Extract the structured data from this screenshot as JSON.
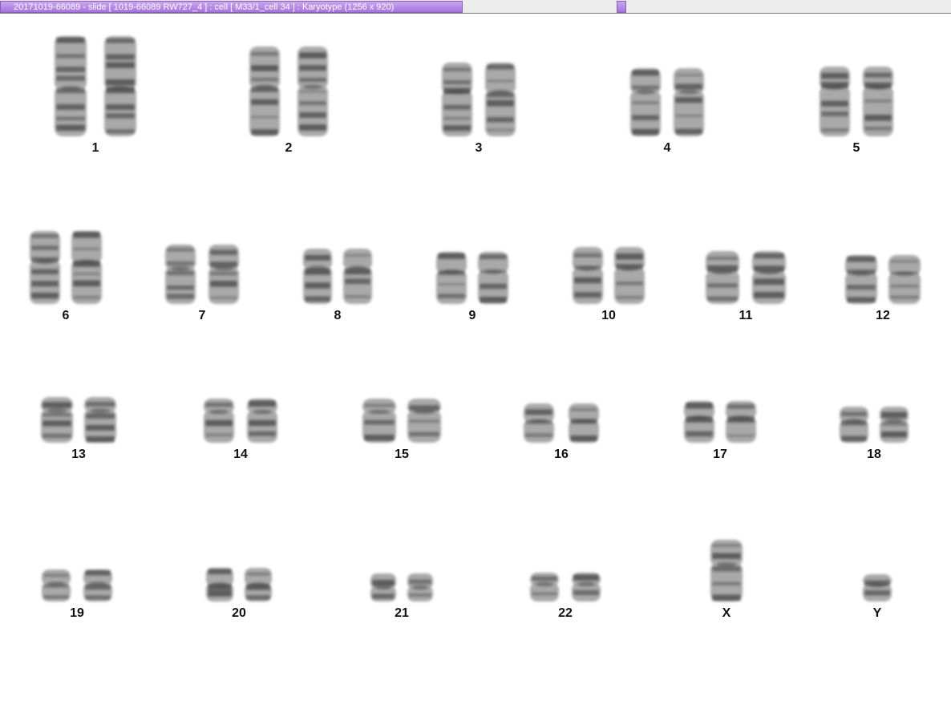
{
  "window": {
    "title": "20171019-66089 - slide [ 1019-66089 RW727_4 ] : cell [ M33/1_cell 34 ] : Karyotype  (1256 x 920)"
  },
  "karyotype": {
    "chromosomes": [
      {
        "label": "1",
        "count": 2
      },
      {
        "label": "2",
        "count": 2
      },
      {
        "label": "3",
        "count": 2
      },
      {
        "label": "4",
        "count": 2
      },
      {
        "label": "5",
        "count": 2
      },
      {
        "label": "6",
        "count": 2
      },
      {
        "label": "7",
        "count": 2
      },
      {
        "label": "8",
        "count": 2
      },
      {
        "label": "9",
        "count": 2
      },
      {
        "label": "10",
        "count": 2
      },
      {
        "label": "11",
        "count": 2
      },
      {
        "label": "12",
        "count": 2
      },
      {
        "label": "13",
        "count": 2
      },
      {
        "label": "14",
        "count": 2
      },
      {
        "label": "15",
        "count": 2
      },
      {
        "label": "16",
        "count": 2
      },
      {
        "label": "17",
        "count": 2
      },
      {
        "label": "18",
        "count": 2
      },
      {
        "label": "19",
        "count": 2
      },
      {
        "label": "20",
        "count": 2
      },
      {
        "label": "21",
        "count": 2
      },
      {
        "label": "22",
        "count": 2
      },
      {
        "label": "X",
        "count": 1
      },
      {
        "label": "Y",
        "count": 1
      }
    ]
  },
  "colors": {
    "titlebar_accent": "#b88be6",
    "chromosome_fill": "#8c8c8c",
    "band_dark": "#4a4a4a"
  }
}
